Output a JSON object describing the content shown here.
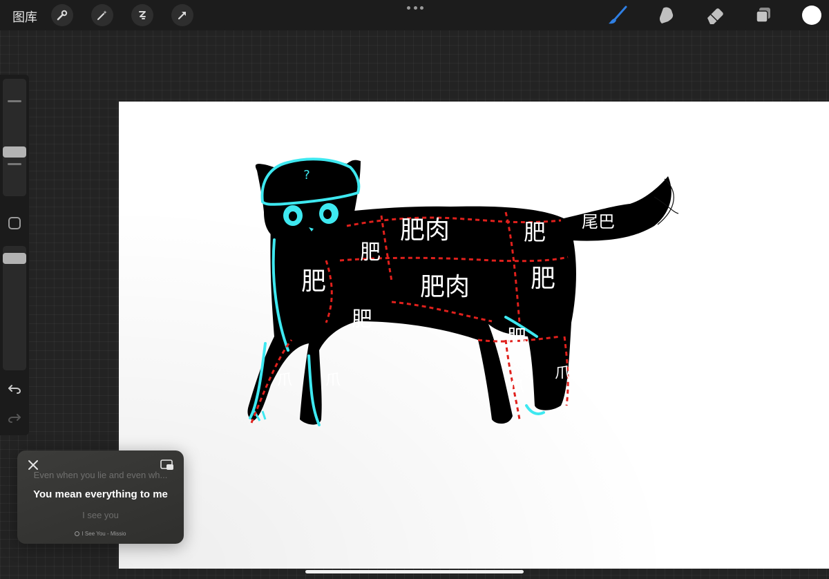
{
  "topbar": {
    "gallery_label": "图库",
    "left_tools": [
      "wrench-icon",
      "magic-wand-icon",
      "selection-icon",
      "transform-arrow-icon"
    ],
    "right_tools": [
      "brush-icon",
      "smudge-icon",
      "eraser-icon",
      "layers-icon",
      "color-icon"
    ],
    "colors": {
      "brush_active": "#2f7fe3",
      "current_color": "#ffffff"
    }
  },
  "sidebar": {
    "tools": [
      "brush-size-slider",
      "modify-button",
      "opacity-slider",
      "undo-icon",
      "redo-icon"
    ]
  },
  "canvas": {
    "drawing_labels": {
      "hat_mark": "?",
      "neck": "肥",
      "chest": "肥",
      "upper_back": "肥肉",
      "belly": "肥肉",
      "rear_upper": "肥",
      "rear_lower": "肥",
      "front_shoulder": "肥",
      "hind_shoulder": "肥",
      "tail": "尾巴",
      "leg_front_left": "爪",
      "leg_front_right": "爪",
      "leg_hind_left": "爪",
      "leg_hind_right": "爪"
    },
    "colors": {
      "outline": "#3ee8f0",
      "cut_lines": "#e0201c",
      "body": "#000000"
    }
  },
  "music_widget": {
    "lyric_previous": "Even when you lie and even wh...",
    "lyric_current": "You mean everything to me",
    "lyric_next": "I see you",
    "song": "I See You - Missio"
  }
}
